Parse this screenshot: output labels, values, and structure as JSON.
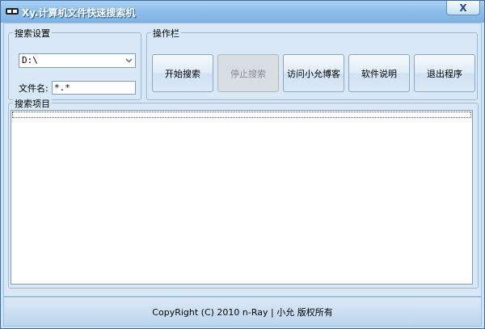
{
  "window": {
    "title": "Xy.计算机文件快速搜索机",
    "close_label": "X"
  },
  "search_settings": {
    "legend": "搜索设置",
    "drive_value": "D:\\",
    "filename_label": "文件名:",
    "filename_value": "*.*"
  },
  "operations": {
    "legend": "操作栏",
    "buttons": [
      {
        "label": "开始搜索",
        "enabled": true
      },
      {
        "label": "停止搜索",
        "enabled": false
      },
      {
        "label": "访问小允博客",
        "enabled": true
      },
      {
        "label": "软件说明",
        "enabled": true
      },
      {
        "label": "退出程序",
        "enabled": true
      }
    ]
  },
  "results": {
    "legend": "搜索项目"
  },
  "footer": {
    "copyright": "CopyRight (C) 2010 n-Ray | 小允 版权所有"
  },
  "icons": {
    "app": "app-logo-icon",
    "close": "close-icon",
    "dropdown": "chevron-down-icon"
  },
  "colors": {
    "title_gradient_top": "#a9d0f2",
    "window_bg": "#d9e8f6",
    "disabled_button": "#d8dde2"
  }
}
